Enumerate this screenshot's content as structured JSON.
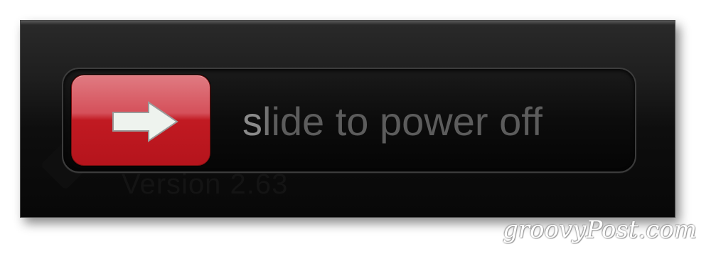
{
  "power_off_slider": {
    "label": "slide to power off",
    "thumb_icon": "right-arrow-icon",
    "thumb_color": "#c11a22"
  },
  "background": {
    "version_text": "Version 2.63"
  },
  "watermark": {
    "text": "groovyPost.com"
  }
}
